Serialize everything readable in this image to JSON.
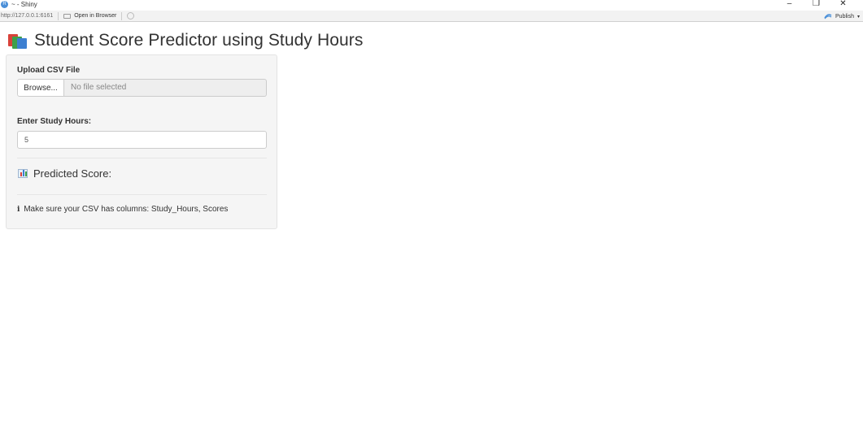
{
  "window": {
    "title": "~ - Shiny",
    "controls": [
      "–",
      "❐",
      "✕"
    ]
  },
  "toolbar": {
    "url": "http://127.0.0.1:6161",
    "open_in_browser": "Open in Browser",
    "publish": "Publish"
  },
  "app": {
    "title": "Student Score Predictor using Study Hours",
    "upload_label": "Upload CSV File",
    "browse_label": "Browse...",
    "file_placeholder": "No file selected",
    "hours_label": "Enter Study Hours:",
    "hours_value": "5",
    "predicted_label": "Predicted Score:",
    "note_icon": "i",
    "note_text": "Make sure your CSV has columns: Study_Hours, Scores"
  },
  "colors": {
    "well_bg": "#f5f5f5",
    "publish_icon": "#4a90d9"
  }
}
